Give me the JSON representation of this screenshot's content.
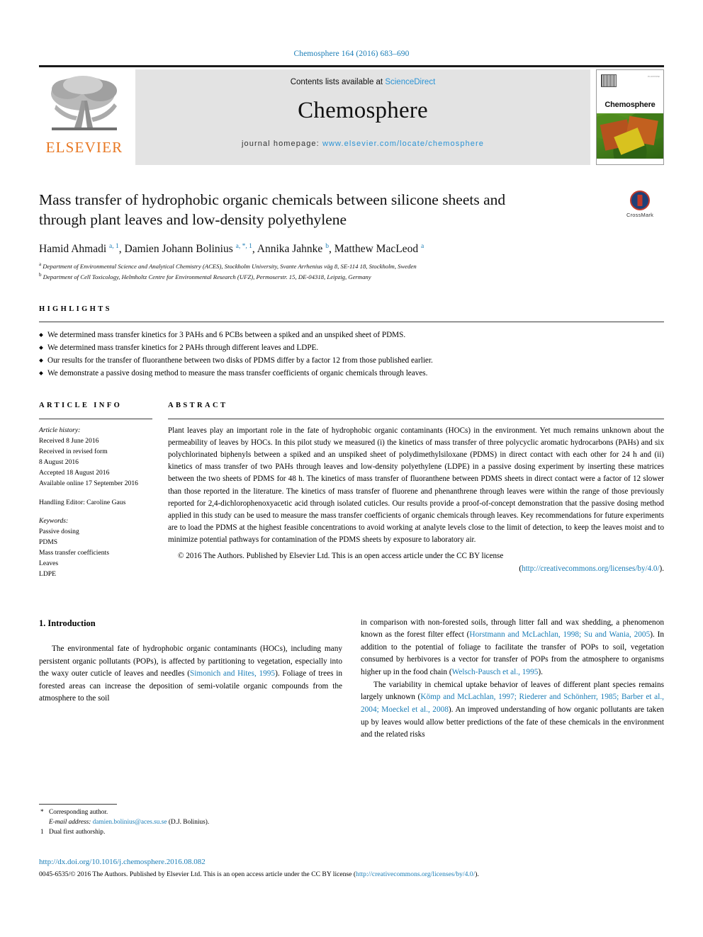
{
  "running_head": "Chemosphere 164 (2016) 683–690",
  "masthead": {
    "publisher_logo_name": "ELSEVIER",
    "contents_prefix": "Contents lists available at ",
    "contents_link": "ScienceDirect",
    "journal_title": "Chemosphere",
    "homepage_prefix": "journal homepage: ",
    "homepage_url": "www.elsevier.com/locate/chemosphere",
    "cover_journal_name": "Chemosphere",
    "cover_tiny_text": "ELSEVIER"
  },
  "article": {
    "title": "Mass transfer of hydrophobic organic chemicals between silicone sheets and through plant leaves and low-density polyethylene",
    "crossmark_label": "CrossMark",
    "authors_html": "Hamid Ahmadi <sup>a, 1</sup>, Damien Johann Bolinius <sup>a, *, 1</sup>, Annika Jahnke <sup>b</sup>, Matthew MacLeod <sup>a</sup>",
    "affiliations": [
      "Department of Environmental Science and Analytical Chemistry (ACES), Stockholm University, Svante Arrhenius väg 8, SE-114 18, Stockholm, Sweden",
      "Department of Cell Toxicology, Helmholtz Centre for Environmental Research (UFZ), Permoserstr. 15, DE-04318, Leipzig, Germany"
    ],
    "affiliation_marks": [
      "a",
      "b"
    ]
  },
  "highlights": {
    "label": "HIGHLIGHTS",
    "items": [
      "We determined mass transfer kinetics for 3 PAHs and 6 PCBs between a spiked and an unspiked sheet of PDMS.",
      "We determined mass transfer kinetics for 2 PAHs through different leaves and LDPE.",
      "Our results for the transfer of fluoranthene between two disks of PDMS differ by a factor 12 from those published earlier.",
      "We demonstrate a passive dosing method to measure the mass transfer coefficients of organic chemicals through leaves."
    ]
  },
  "article_info": {
    "label": "ARTICLE INFO",
    "history_heading": "Article history:",
    "history": [
      "Received 8 June 2016",
      "Received in revised form",
      "8 August 2016",
      "Accepted 18 August 2016",
      "Available online 17 September 2016"
    ],
    "handling_editor": "Handling Editor: Caroline Gaus",
    "keywords_heading": "Keywords:",
    "keywords": [
      "Passive dosing",
      "PDMS",
      "Mass transfer coefficients",
      "Leaves",
      "LDPE"
    ]
  },
  "abstract": {
    "label": "ABSTRACT",
    "text": "Plant leaves play an important role in the fate of hydrophobic organic contaminants (HOCs) in the environment. Yet much remains unknown about the permeability of leaves by HOCs. In this pilot study we measured (i) the kinetics of mass transfer of three polycyclic aromatic hydrocarbons (PAHs) and six polychlorinated biphenyls between a spiked and an unspiked sheet of polydimethylsiloxane (PDMS) in direct contact with each other for 24 h and (ii) kinetics of mass transfer of two PAHs through leaves and low-density polyethylene (LDPE) in a passive dosing experiment by inserting these matrices between the two sheets of PDMS for 48 h. The kinetics of mass transfer of fluoranthene between PDMS sheets in direct contact were a factor of 12 slower than those reported in the literature. The kinetics of mass transfer of fluorene and phenanthrene through leaves were within the range of those previously reported for 2,4-dichlorophenoxyacetic acid through isolated cuticles. Our results provide a proof-of-concept demonstration that the passive dosing method applied in this study can be used to measure the mass transfer coefficients of organic chemicals through leaves. Key recommendations for future experiments are to load the PDMS at the highest feasible concentrations to avoid working at analyte levels close to the limit of detection, to keep the leaves moist and to minimize potential pathways for contamination of the PDMS sheets by exposure to laboratory air.",
    "copyright_text": "© 2016 The Authors. Published by Elsevier Ltd. This is an open access article under the CC BY license",
    "copyright_link": "http://creativecommons.org/licenses/by/4.0/"
  },
  "body": {
    "section_number_title": "1. Introduction",
    "left_paragraphs": [
      "The environmental fate of hydrophobic organic contaminants (HOCs), including many persistent organic pollutants (POPs), is affected by partitioning to vegetation, especially into the waxy outer cuticle of leaves and needles (<span class=\"link\">Simonich and Hites, 1995</span>). Foliage of trees in forested areas can increase the deposition of semi-volatile organic compounds from the atmosphere to the soil"
    ],
    "right_paragraphs": [
      "in comparison with non-forested soils, through litter fall and wax shedding, a phenomenon known as the forest filter effect (<span class=\"link\">Horstmann and McLachlan, 1998; Su and Wania, 2005</span>). In addition to the potential of foliage to facilitate the transfer of POPs to soil, vegetation consumed by herbivores is a vector for transfer of POPs from the atmosphere to organisms higher up in the food chain (<span class=\"link\">Welsch-Pausch et al., 1995</span>).",
      "The variability in chemical uptake behavior of leaves of different plant species remains largely unknown (<span class=\"link\">Kömp and McLachlan, 1997; Riederer and Schönherr, 1985; Barber et al., 2004; Moeckel et al., 2008</span>). An improved understanding of how organic pollutants are taken up by leaves would allow better predictions of the fate of these chemicals in the environment and the related risks"
    ]
  },
  "footnotes": {
    "corresponding_mark": "*",
    "corresponding_text": "Corresponding author.",
    "email_label": "E-mail address:",
    "email": "damien.bolinius@aces.su.se",
    "email_suffix": "(D.J. Bolinius).",
    "dual_mark": "1",
    "dual_text": "Dual first authorship."
  },
  "bottom": {
    "doi": "http://dx.doi.org/10.1016/j.chemosphere.2016.08.082",
    "issn_prefix": "0045-6535/© 2016 The Authors. Published by Elsevier Ltd. This is an open access article under the CC BY license (",
    "issn_link": "http://creativecommons.org/licenses/by/4.0/",
    "issn_suffix": ")."
  },
  "colors": {
    "link_blue": "#1a7db6",
    "elsevier_orange": "#e87722",
    "band_gray": "#e3e3e3"
  }
}
